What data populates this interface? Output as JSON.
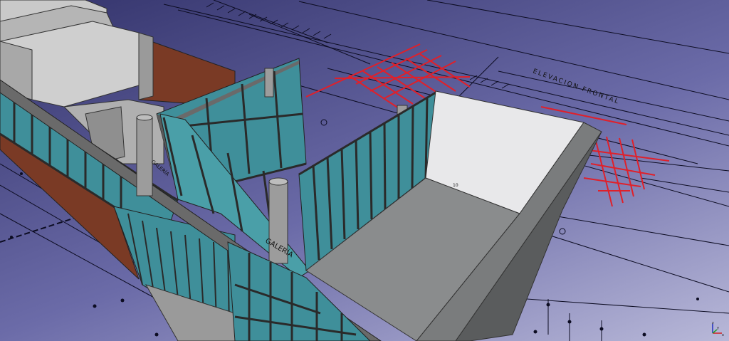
{
  "viewport": {
    "drawing_label": "ELEVACION FRONTAL",
    "building_sign": "GALERÍA",
    "floor_tag": "10"
  },
  "axes": {
    "x": "x",
    "y": "y",
    "z": "z"
  },
  "colors": {
    "background_top": "#33336b",
    "background_bottom": "#b8b8d8",
    "glass": "#3f8f9a",
    "brick": "#7a3a25",
    "concrete": "#b9b9b9",
    "highlight_lines": "#e0202a"
  }
}
